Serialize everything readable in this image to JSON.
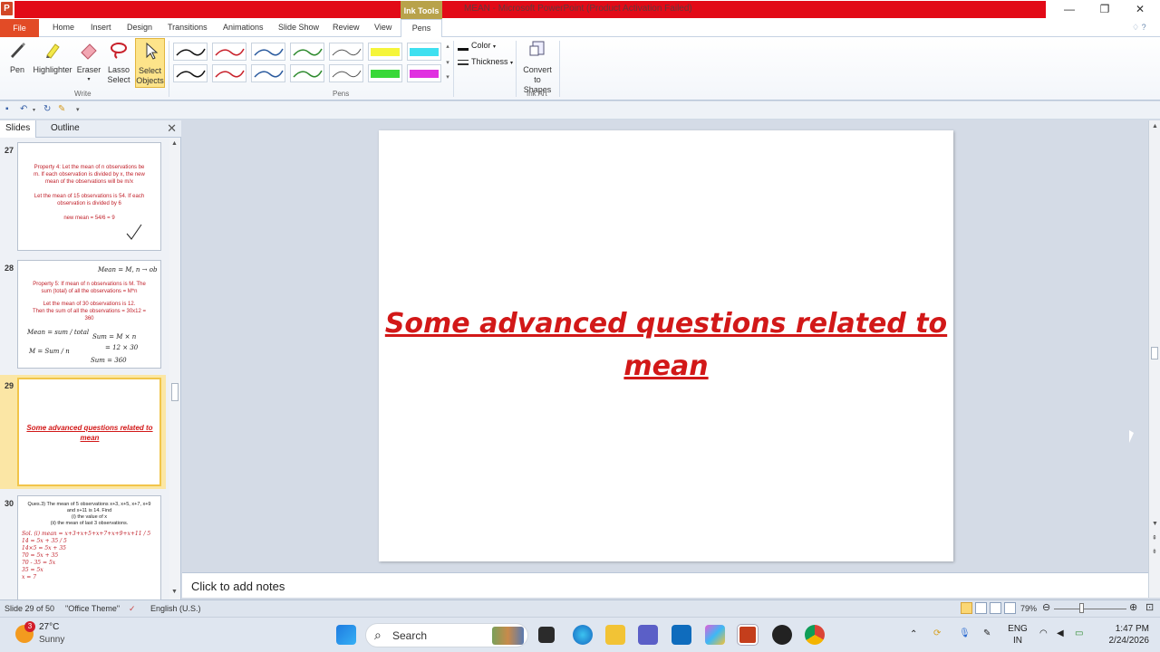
{
  "window": {
    "app_icon_letter": "P",
    "context_tab": "Ink Tools",
    "title": "MEAN  -  Microsoft PowerPoint (Product Activation Failed)",
    "minimize": "—",
    "restore": "❐",
    "close": "✕"
  },
  "tabs": {
    "file": "File",
    "items": [
      "Home",
      "Insert",
      "Design",
      "Transitions",
      "Animations",
      "Slide Show",
      "Review",
      "View"
    ],
    "pens": "Pens",
    "help_glyphs": "♢ ?"
  },
  "ribbon": {
    "write_group": "Write",
    "pens_group": "Pens",
    "inkart_group": "Ink Art",
    "pen_label": "Pen",
    "highlighter_label": "Highlighter",
    "eraser_label": "Eraser",
    "lasso_label_1": "Lasso",
    "lasso_label_2": "Select",
    "select_label_1": "Select",
    "select_label_2": "Objects",
    "color_label": "Color",
    "thickness_label": "Thickness",
    "convert_label_1": "Convert",
    "convert_label_2": "to Shapes",
    "pen_colors_row1": [
      "#111111",
      "#c8202a",
      "#2a5a9e",
      "#2d8a2d",
      "#555555",
      "#f5f53a",
      "#3ee0f0"
    ],
    "pen_colors_row2": [
      "#111111",
      "#c8202a",
      "#2a5a9e",
      "#2d8a2d",
      "#555555",
      "#38d838",
      "#e030e0"
    ]
  },
  "slides_panel": {
    "tab_slides": "Slides",
    "tab_outline": "Outline",
    "close": "✕",
    "thumbs": [
      {
        "number": "27",
        "lines": [
          "Property 4: Let the mean of n observations be",
          "m. If each observation is divided by x, the new",
          "mean of the observations will be m/x",
          "",
          "Let the mean of 15 observations is 54. If each",
          "observation is divided by 6",
          "",
          "new mean = 54/6 = 9"
        ]
      },
      {
        "number": "28",
        "lines": [
          "Property 5: If mean of n observations is M. The",
          "sum (total) of all the observations = M*n",
          "",
          "Let the mean of 30 observations is 12.",
          "Then the sum of all the observations = 30x12 =",
          "360"
        ],
        "ink": [
          "Mean = M,  n → ob",
          "Mean = sum / total",
          "Sum = M × n",
          "M = Sum / n",
          "= 12 × 30",
          "Sum = 360"
        ]
      },
      {
        "number": "29",
        "title": "Some advanced questions related to mean"
      },
      {
        "number": "30",
        "lines": [
          "Ques.3) The mean of 5 observations x+3, x+5, x+7, x+9",
          "and x+11 is 14. Find",
          "(i) the value of x",
          "(ii) the mean of last 3 observations."
        ],
        "ink": [
          "Sol. (i)  mean = x+3+x+5+x+7+x+9+x+11 / 5",
          "14 = 5x + 35 / 5",
          "14×5 = 5x + 35",
          "70 = 5x + 35",
          "70 - 35 = 5x",
          "35 = 5x",
          "x = 7"
        ]
      }
    ]
  },
  "slide": {
    "title": "Some advanced questions related to mean"
  },
  "notes": {
    "placeholder": "Click to add notes"
  },
  "status": {
    "slide_of": "Slide 29 of 50",
    "theme": "\"Office Theme\"",
    "language": "English (U.S.)",
    "zoom": "79%"
  },
  "taskbar": {
    "weather_badge": "3",
    "temperature": "27°C",
    "weather_desc": "Sunny",
    "search_label": "Search",
    "lang_1": "ENG",
    "lang_2": "IN",
    "time": "1:47 PM",
    "date": "2/24/2026"
  }
}
